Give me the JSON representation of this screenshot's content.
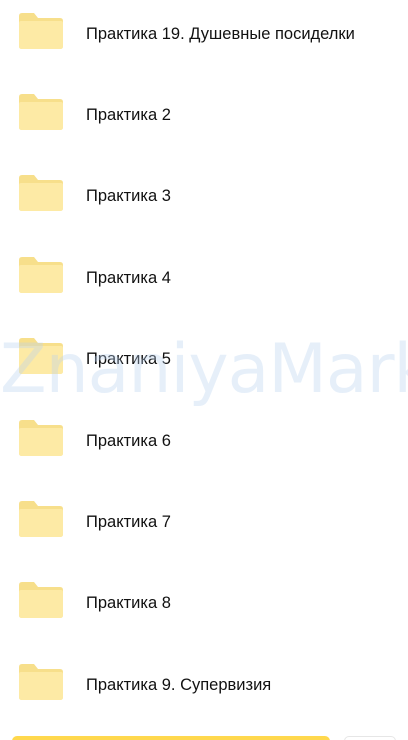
{
  "folders": [
    {
      "label": "Практика 19. Душевные посиделки",
      "icon": "folder-icon"
    },
    {
      "label": "Практика 2",
      "icon": "folder-icon"
    },
    {
      "label": "Практика 3",
      "icon": "folder-icon"
    },
    {
      "label": "Практика 4",
      "icon": "folder-icon"
    },
    {
      "label": "Практика 5",
      "icon": "folder-icon"
    },
    {
      "label": "Практика 6",
      "icon": "folder-icon"
    },
    {
      "label": "Практика 7",
      "icon": "folder-icon"
    },
    {
      "label": "Практика 8",
      "icon": "folder-icon"
    },
    {
      "label": "Практика 9. Супервизия",
      "icon": "folder-icon"
    }
  ],
  "watermark": "ZnaniyaMarket",
  "colors": {
    "folder_fill": "#fdeaa5",
    "folder_tab": "#f7df8b",
    "accent": "#ffd84d",
    "text": "#111111"
  }
}
